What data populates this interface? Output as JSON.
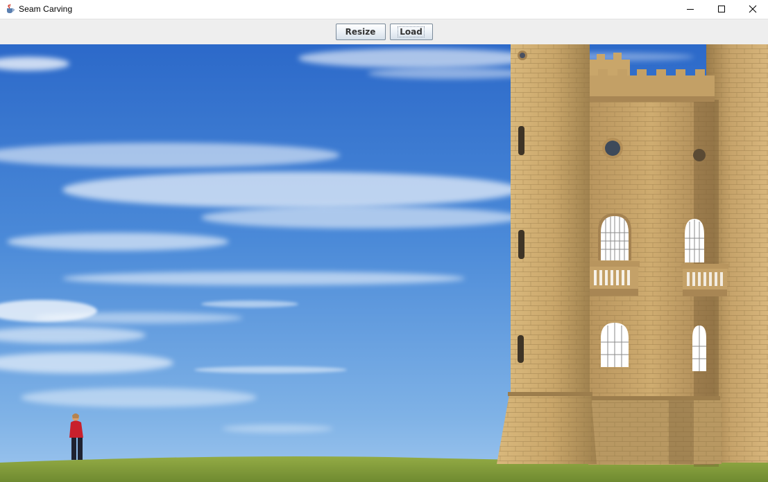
{
  "window": {
    "title": "Seam Carving",
    "app_icon": "java-cup-icon",
    "controls": [
      "minimize-icon",
      "maximize-icon",
      "close-icon"
    ]
  },
  "toolbar": {
    "resize_label": "Resize",
    "load_label": "Load"
  },
  "image": {
    "description_icon": "photo-canvas",
    "colors": {
      "sky_top": "#2f6fce",
      "sky_bottom": "#8cbcec",
      "grass": "#7e9a3a",
      "stone": "#c8a468",
      "stone_shadow": "#9c7d4c"
    }
  }
}
